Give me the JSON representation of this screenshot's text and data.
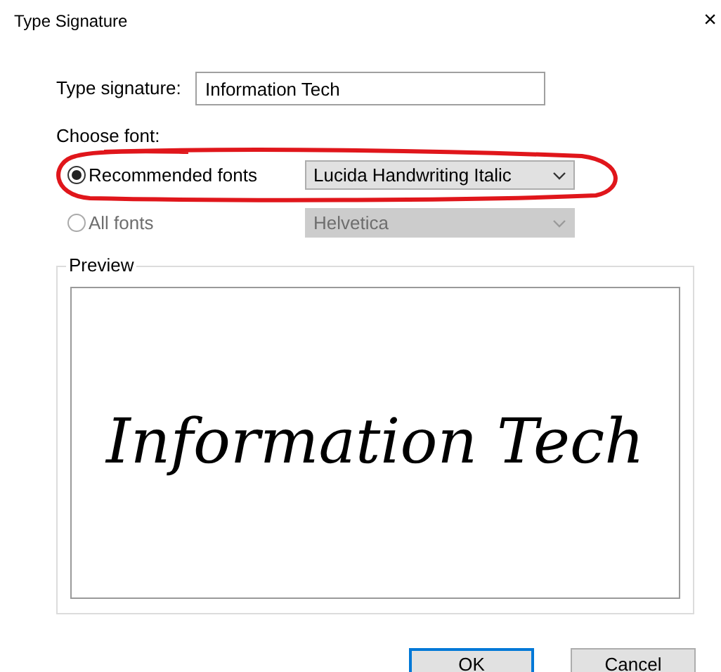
{
  "window": {
    "title": "Type Signature",
    "close": "×"
  },
  "signature_field": {
    "label": "Type signature:",
    "value": "Information Tech"
  },
  "font_group": {
    "label": "Choose font:",
    "options": [
      {
        "label": "Recommended fonts",
        "selected": true,
        "dropdown": "Lucida Handwriting Italic",
        "disabled": false
      },
      {
        "label": "All fonts",
        "selected": false,
        "dropdown": "Helvetica",
        "disabled": true
      }
    ]
  },
  "preview": {
    "label": "Preview",
    "text": "Information Tech"
  },
  "buttons": [
    {
      "label": "OK",
      "default": true
    },
    {
      "label": "Cancel",
      "default": false
    }
  ]
}
